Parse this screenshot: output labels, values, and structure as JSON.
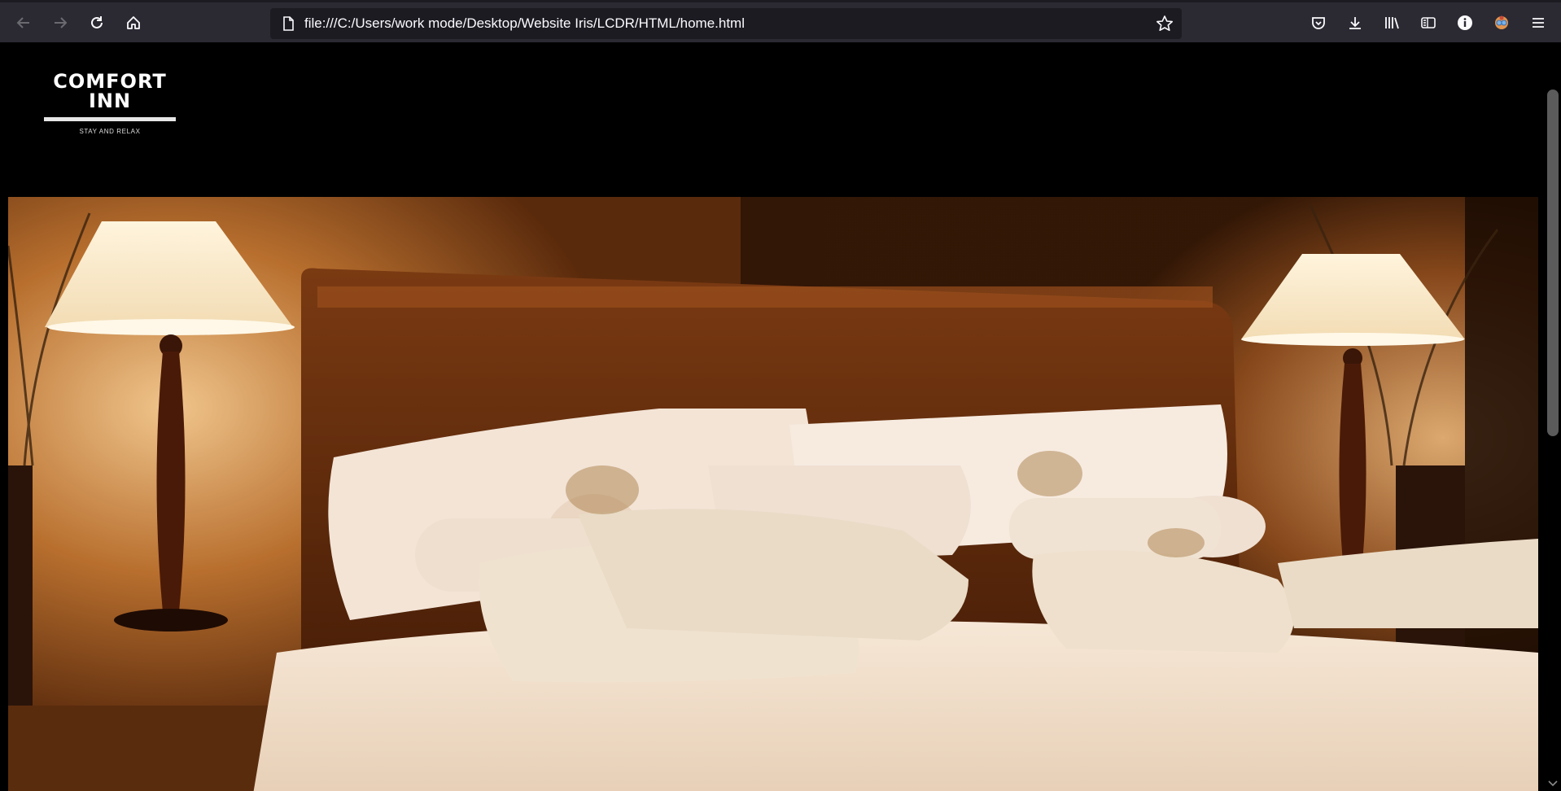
{
  "browser": {
    "url": "file:///C:/Users/work mode/Desktop/Website Iris/LCDR/HTML/home.html",
    "icons": {
      "back": "arrow-left-icon",
      "forward": "arrow-right-icon",
      "reload": "reload-icon",
      "home": "home-icon",
      "page": "page-icon",
      "bookmark": "star-icon",
      "pocket": "pocket-icon",
      "downloads": "download-icon",
      "library": "library-icon",
      "sidebar": "sidebar-icon",
      "extension": "info-icon",
      "account": "avatar-icon",
      "menu": "hamburger-menu-icon"
    }
  },
  "site": {
    "logo_line1": "COMFORT",
    "logo_line2": "INN",
    "tagline": "STAY AND RELAX"
  },
  "colors": {
    "chrome_bg": "#2b2a33",
    "urlbar_bg": "#1c1b22",
    "page_bg": "#000000",
    "text_light": "#fbfbfe"
  }
}
